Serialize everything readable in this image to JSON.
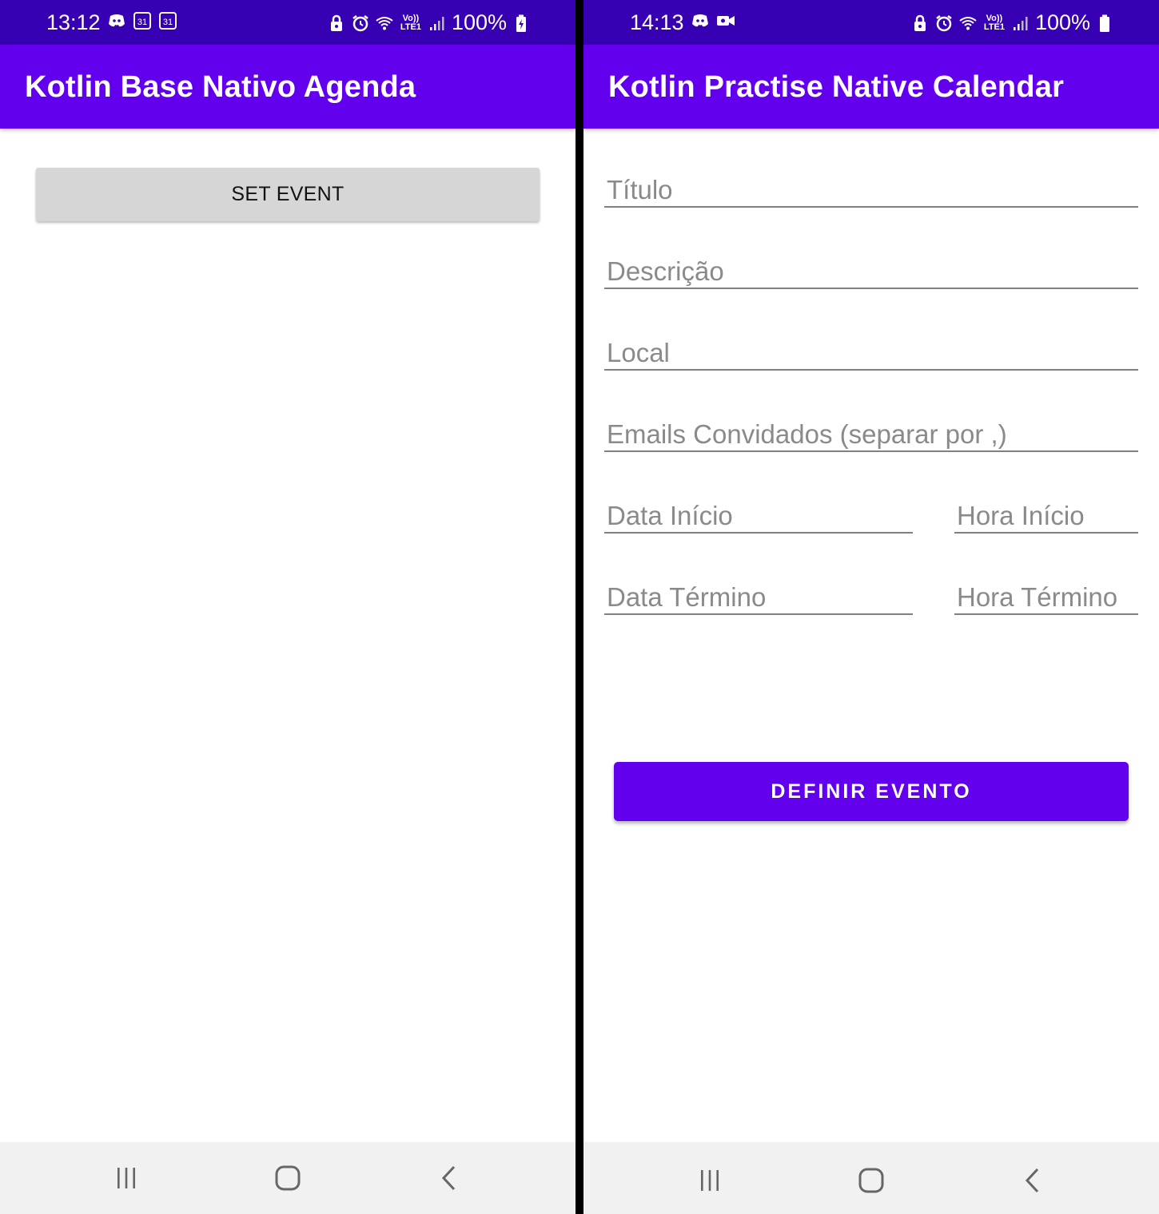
{
  "left_screen": {
    "status_bar": {
      "time": "13:12",
      "left_icons": [
        "discord-icon",
        "calendar-31-icon",
        "calendar-31-icon"
      ],
      "calendar_day": "31",
      "signal_label": "Vo)) LTE1",
      "battery_percent": "100%",
      "charging": true
    },
    "app_bar": {
      "title": "Kotlin Base Nativo Agenda"
    },
    "set_event_button": {
      "label": "SET EVENT"
    }
  },
  "right_screen": {
    "status_bar": {
      "time": "14:13",
      "left_icons": [
        "discord-icon",
        "video-camera-icon"
      ],
      "signal_label": "Vo)) LTE1",
      "battery_percent": "100%",
      "charging": false
    },
    "app_bar": {
      "title": "Kotlin Practise Native Calendar"
    },
    "form": {
      "title_placeholder": "Título",
      "description_placeholder": "Descrição",
      "location_placeholder": "Local",
      "guests_placeholder": "Emails Convidados (separar por ,)",
      "start_date_placeholder": "Data Início",
      "start_time_placeholder": "Hora Início",
      "end_date_placeholder": "Data Término",
      "end_time_placeholder": "Hora Término"
    },
    "define_event_button": {
      "label": "DEFINIR EVENTO"
    }
  },
  "nav_bar": {
    "buttons": [
      "recent-apps-icon",
      "home-icon",
      "back-icon"
    ]
  },
  "colors": {
    "status_bar": "#3700b3",
    "app_bar": "#6200ee",
    "accent_button": "#6200ee",
    "gray_button": "#d6d6d6",
    "divider": "#000000",
    "nav_bar": "#f1f1f1"
  }
}
